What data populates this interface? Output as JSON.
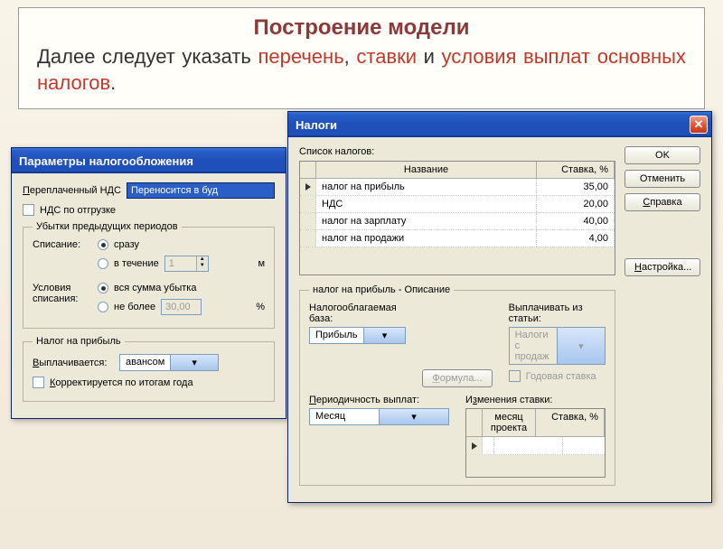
{
  "header": {
    "title": "Построение модели",
    "text_1": "Далее следует указать ",
    "perechen": "перечень",
    "comma1": ", ",
    "stavki": "ставки",
    "and_word": " и ",
    "usloviya": "условия выплат основных налогов",
    "period": "."
  },
  "win1": {
    "title": "Параметры налогообложения",
    "label_nds": "Переплаченный НДС",
    "nds_value": "Переносится в буд",
    "checkbox_nds_ship": "НДС по отгрузке",
    "fieldset_loss": "Убытки предыдущих периодов",
    "label_spisanie": "Списание:",
    "radio_srazu": "сразу",
    "radio_techenie": "в течение",
    "spin_val": "1",
    "unit_m": "м",
    "label_usloviya": "Условия списания:",
    "radio_vsya": "вся сумма убытка",
    "radio_nebolee": "не более",
    "nebolee_val": "30,00",
    "unit_pct": "%",
    "fieldset_profit": "Налог на прибыль",
    "label_vyplach": "Выплачивается:",
    "combo_avansom": "авансом",
    "checkbox_korrekt": "Корректируется по итогам года"
  },
  "win2": {
    "title": "Налоги",
    "label_list": "Список налогов:",
    "grid_col_name": "Название",
    "grid_col_rate": "Ставка, %",
    "rows": [
      {
        "name": "налог на прибыль",
        "rate": "35,00"
      },
      {
        "name": "НДС",
        "rate": "20,00"
      },
      {
        "name": "налог на зарплату",
        "rate": "40,00"
      },
      {
        "name": "налог на продажи",
        "rate": "4,00"
      }
    ],
    "fieldset_desc": "налог на прибыль - Описание",
    "label_base": "Налогооблагаемая база:",
    "combo_base": "Прибыль",
    "btn_formula": "Формула...",
    "label_paystat": "Выплачивать из статьи:",
    "combo_paystat": "Налоги с продаж",
    "checkbox_annual": "Годовая ставка",
    "label_period": "Периодичность выплат:",
    "combo_period": "Месяц",
    "label_changes": "Изменения ставки:",
    "grid2_col_month": "месяц проекта",
    "grid2_col_rate": "Ставка, %",
    "btn_ok": "OK",
    "btn_cancel": "Отменить",
    "btn_help": "Справка",
    "btn_setup": "Настройка..."
  }
}
